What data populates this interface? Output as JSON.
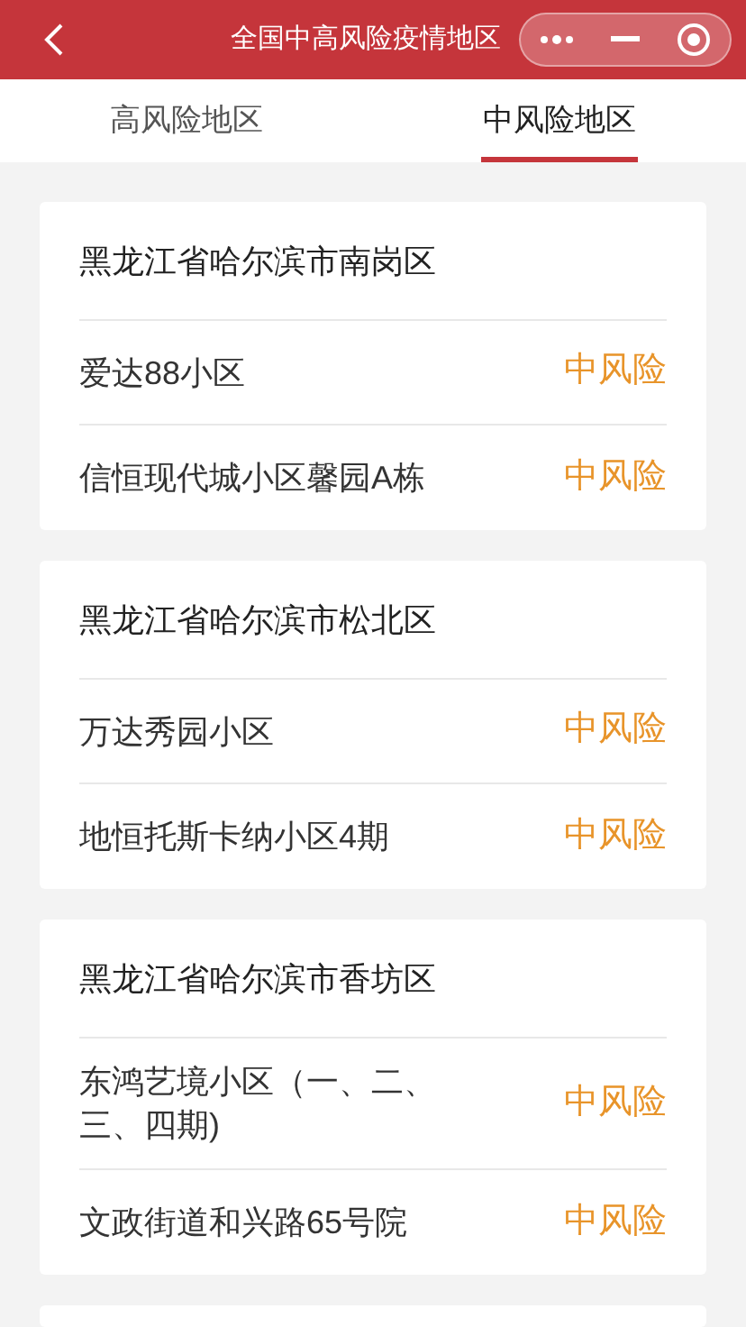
{
  "header": {
    "title": "全国中高风险疫情地区"
  },
  "tabs": [
    {
      "label": "高风险地区",
      "selected": false
    },
    {
      "label": "中风险地区",
      "selected": true
    }
  ],
  "groups": [
    {
      "region": "黑龙江省哈尔滨市南岗区",
      "items": [
        {
          "name": "爱达88小区",
          "risk": "中风险"
        },
        {
          "name": "信恒现代城小区馨园A栋",
          "risk": "中风险"
        }
      ]
    },
    {
      "region": "黑龙江省哈尔滨市松北区",
      "items": [
        {
          "name": "万达秀园小区",
          "risk": "中风险"
        },
        {
          "name": "地恒托斯卡纳小区4期",
          "risk": "中风险"
        }
      ]
    },
    {
      "region": "黑龙江省哈尔滨市香坊区",
      "items": [
        {
          "name": "东鸿艺境小区（一、二、三、四期)",
          "risk": "中风险"
        },
        {
          "name": "文政街道和兴路65号院",
          "risk": "中风险"
        }
      ]
    }
  ]
}
